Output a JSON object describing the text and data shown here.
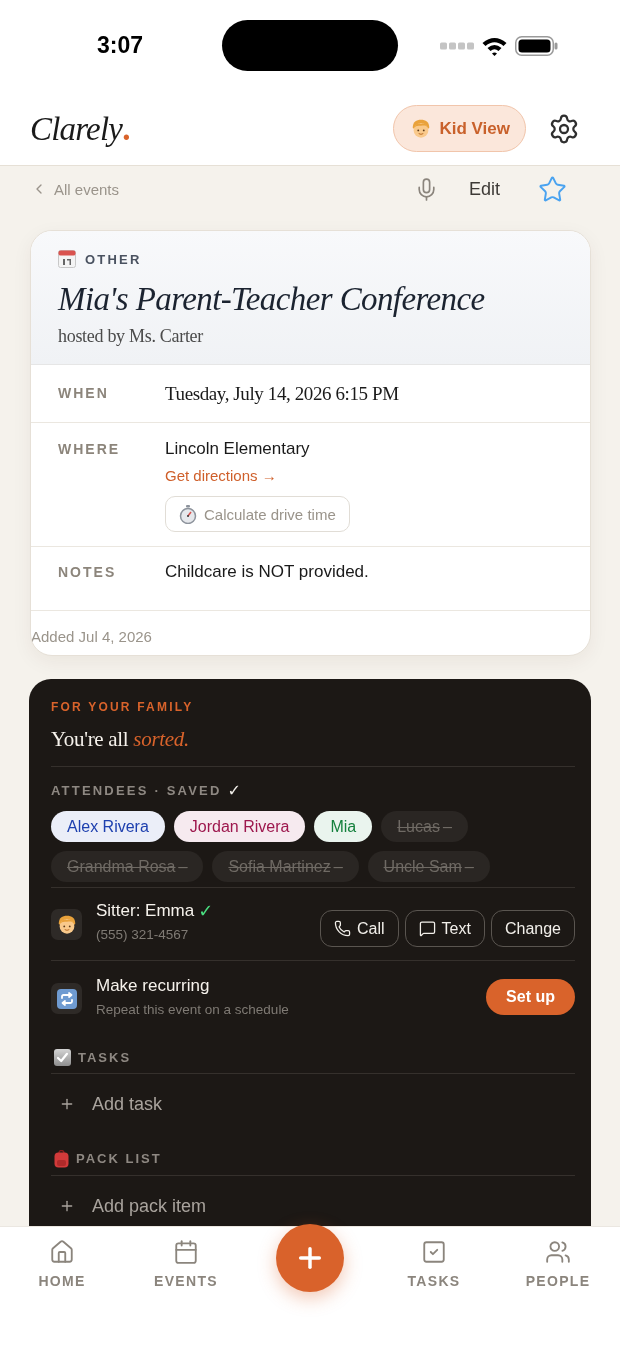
{
  "status_bar": {
    "time": "3:07"
  },
  "header": {
    "logo": {
      "text": "Clarely",
      "dot": "."
    },
    "kid_view_button": "Kid View"
  },
  "toolbar": {
    "back_link": "All events",
    "edit_button": "Edit",
    "starred": false
  },
  "event": {
    "category": "OTHER",
    "title": "Mia's Parent-Teacher Conference",
    "host": "hosted by Ms. Carter",
    "details": [
      {
        "kind": "date",
        "label": "WHEN",
        "value": "Tuesday, July 14, 2026 6:15 PM"
      },
      {
        "kind": "place",
        "label": "WHERE",
        "value": "Lincoln Elementary",
        "link": "Get directions →",
        "button": "Calculate drive time"
      },
      {
        "kind": "text",
        "label": "NOTES",
        "value": "Childcare is NOT provided."
      }
    ],
    "added": "Added Jul 4, 2026"
  },
  "family": {
    "eyebrow": "FOR YOUR FAMILY",
    "headline": "You're all *sorted.*",
    "attendees_label": "ATTENDEES · SAVED",
    "saved_mark": "✓",
    "attendees": [
      {
        "name": "Alex Rivera",
        "selected": true,
        "color": "#1e40af"
      },
      {
        "name": "Jordan Rivera",
        "selected": true,
        "color": "#9d174d"
      },
      {
        "name": "Mia",
        "selected": true,
        "color": "#15803d"
      },
      {
        "name": "Lucas",
        "selected": false,
        "suffix": "–"
      },
      {
        "name": "Grandma Rosa",
        "selected": false,
        "suffix": "–"
      },
      {
        "name": "Sofia Martinez",
        "selected": false,
        "suffix": "–"
      },
      {
        "name": "Uncle Sam",
        "selected": false,
        "suffix": "–"
      }
    ],
    "sitter": {
      "name": "Sitter: Emma",
      "confirmed_mark": "✓",
      "phone": "(555) 321-4567",
      "actions": [
        {
          "kind": "call",
          "label": "Call"
        },
        {
          "kind": "text",
          "label": "Text"
        },
        {
          "kind": "change",
          "label": "Change"
        }
      ]
    },
    "recurring": {
      "title": "Make recurring",
      "subtitle": "Repeat this event on a schedule",
      "button": "Set up"
    },
    "sections": [
      {
        "kind": "tasks",
        "title": "TASKS",
        "add_label": "Add task"
      },
      {
        "kind": "pack",
        "title": "PACK LIST",
        "add_label": "Add pack item"
      }
    ]
  },
  "nav": {
    "items": [
      {
        "kind": "home",
        "label": "HOME",
        "selected": false
      },
      {
        "kind": "events",
        "label": "EVENTS",
        "selected": false
      },
      {
        "kind": "tasks",
        "label": "TASKS",
        "selected": false
      },
      {
        "kind": "people",
        "label": "PEOPLE",
        "selected": false
      }
    ]
  }
}
